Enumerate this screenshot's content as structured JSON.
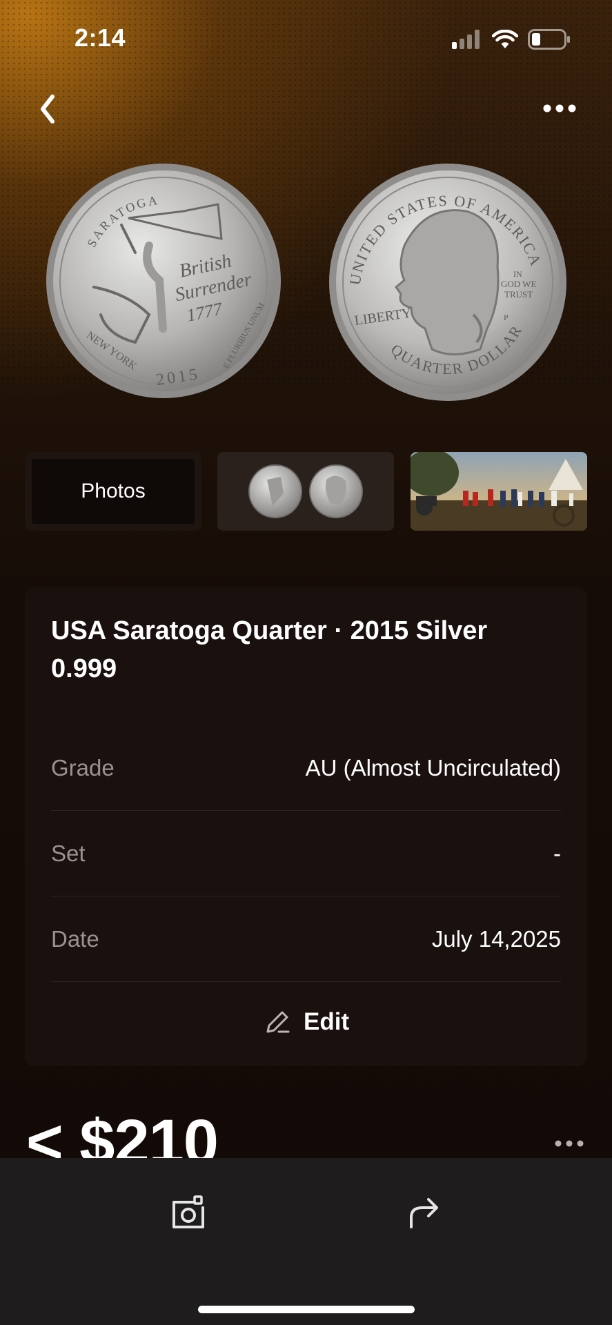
{
  "status_bar": {
    "time": "2:14",
    "icons": [
      "cellular-signal-icon",
      "wifi-icon",
      "battery-icon"
    ]
  },
  "nav": {
    "back_icon": "chevron-left-icon",
    "more_icon": "ellipsis-icon"
  },
  "hero": {
    "coin_left_inscriptions": [
      "SARATOGA",
      "British",
      "Surrender",
      "1777",
      "NEW YORK",
      "2015",
      "E PLURIBUS UNUM"
    ],
    "coin_right_inscriptions": [
      "UNITED STATES OF AMERICA",
      "IN",
      "GOD WE",
      "TRUST",
      "LIBERTY",
      "P",
      "QUARTER DOLLAR"
    ]
  },
  "thumbnails": {
    "photos_label": "Photos",
    "items": [
      "coin-pair-thumbnail",
      "painting-thumbnail"
    ]
  },
  "details": {
    "title": "USA Saratoga Quarter · 2015 Silver 0.999",
    "rows": [
      {
        "label": "Grade",
        "value": "AU (Almost Uncirculated)"
      },
      {
        "label": "Set",
        "value": "-"
      },
      {
        "label": "Date",
        "value": "July 14,2025"
      }
    ],
    "edit_label": "Edit",
    "edit_icon": "pencil-icon"
  },
  "price": {
    "text": "< $210",
    "more_icon": "ellipsis-icon"
  },
  "toolbar": {
    "items": [
      "camera-icon",
      "share-icon"
    ]
  },
  "colors": {
    "background": "#120a07",
    "card": "#1a110f",
    "accent_glow": "#be7814",
    "label_gray": "#9a9290"
  }
}
